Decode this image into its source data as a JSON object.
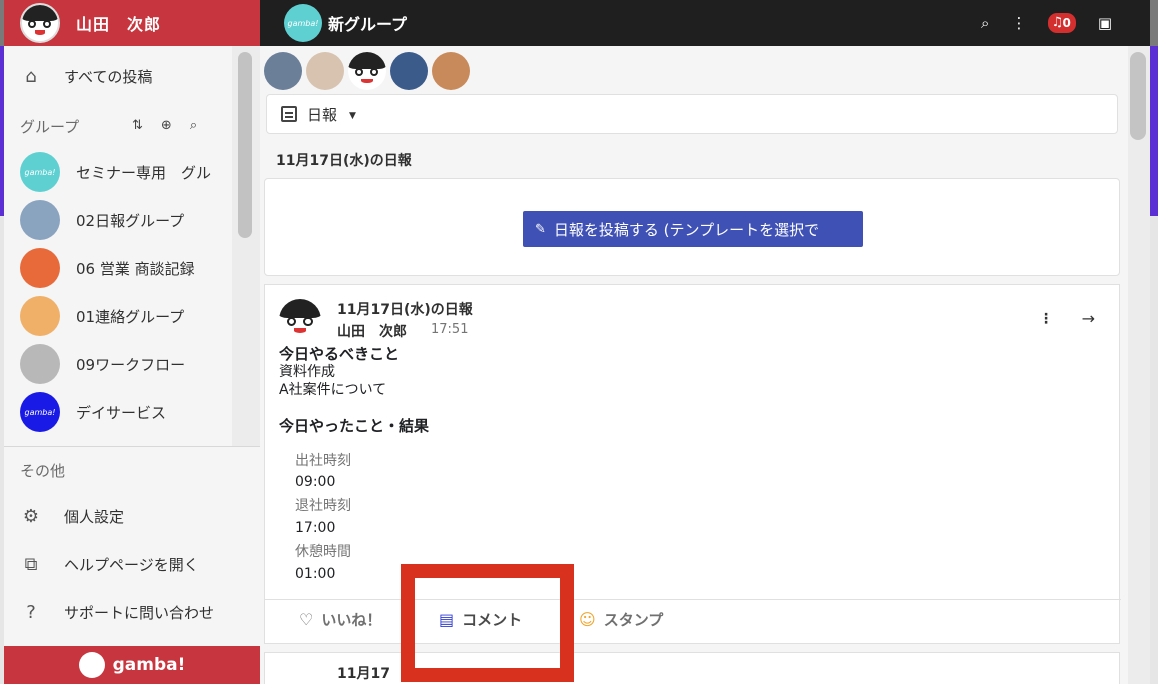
{
  "sidebar": {
    "user_name": "山田　次郎",
    "all_posts": "すべての投稿",
    "groups_title": "グループ",
    "groups": [
      {
        "label": "セミナー専用　グル",
        "color": "#5fd0d2",
        "icon_text": "gamba!"
      },
      {
        "label": "02日報グループ",
        "color": "#8aa4c0",
        "icon_text": ""
      },
      {
        "label": "06 営業 商談記録",
        "color": "#e86a3a",
        "icon_text": ""
      },
      {
        "label": "01連絡グループ",
        "color": "#f0b068",
        "icon_text": ""
      },
      {
        "label": "09ワークフロー",
        "color": "#b8b8b8",
        "icon_text": ""
      },
      {
        "label": "デイサービス",
        "color": "#1a1ae6",
        "icon_text": "gamba!"
      }
    ],
    "other_title": "その他",
    "personal_settings": "個人設定",
    "open_help": "ヘルプページを開く",
    "contact_support": "サポートに問い合わせ",
    "footer_logo": "gamba!"
  },
  "topbar": {
    "group_name": "新グループ",
    "logo_text": "gamba!",
    "notification_count": "0"
  },
  "members": [
    {
      "name": "member-1",
      "color": "#6b7f99"
    },
    {
      "name": "member-2",
      "color": "#d7c3b0"
    },
    {
      "name": "member-3",
      "color": "#ffffff"
    },
    {
      "name": "member-4",
      "color": "#3b5b8a"
    },
    {
      "name": "member-5",
      "color": "#c88a5a"
    }
  ],
  "filter": {
    "selected": "日報"
  },
  "date_heading": "11月17日(水)の日報",
  "post_button": "日報を投稿する (テンプレートを選択で",
  "post": {
    "title": "11月17日(水)の日報",
    "author": "山田　次郎",
    "time": "17:51",
    "todo_heading": "今日やるべきこと",
    "todo_lines": [
      "資料作成",
      "A社案件について"
    ],
    "done_heading": "今日やったこと・結果",
    "fields": [
      {
        "label": "出社時刻",
        "value": "09:00"
      },
      {
        "label": "退社時刻",
        "value": "17:00"
      },
      {
        "label": "休憩時間",
        "value": "01:00"
      }
    ],
    "actions": {
      "like": "いいね！",
      "comment": "コメント",
      "stamp": "スタンプ"
    }
  },
  "next_post_title": "11月17"
}
